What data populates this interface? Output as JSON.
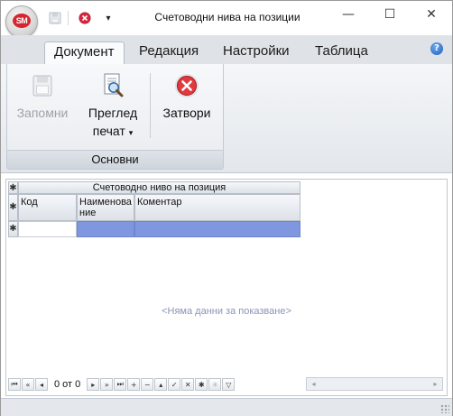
{
  "window": {
    "title": "Счетоводни нива на позиции",
    "app_badge": "SM",
    "controls": {
      "minimize": "—",
      "maximize": "☐",
      "close": "✕"
    }
  },
  "quick_access": {
    "items": [
      {
        "name": "save-icon",
        "enabled": false
      },
      {
        "name": "close-icon",
        "enabled": true
      }
    ],
    "dropdown": "▾"
  },
  "ribbon": {
    "tabs": [
      {
        "label": "Документ",
        "active": true
      },
      {
        "label": "Редакция",
        "active": false
      },
      {
        "label": "Настройки",
        "active": false
      },
      {
        "label": "Таблица",
        "active": false
      }
    ],
    "help": "?",
    "groups": [
      {
        "label": "Основни",
        "buttons": [
          {
            "label": "Запомни",
            "icon": "save-icon",
            "enabled": false
          },
          {
            "label_line1": "Преглед",
            "label_line2": "печат",
            "dropdown": "▾",
            "icon": "print-preview-icon",
            "enabled": true
          },
          {
            "label": "Затвори",
            "icon": "close-icon",
            "enabled": true
          }
        ]
      }
    ]
  },
  "grid": {
    "band_caption": "Счетоводно ниво на позиция",
    "columns": [
      {
        "label": "Код"
      },
      {
        "label": "Наименование",
        "label_line1": "Наименова",
        "label_line2": "ние"
      },
      {
        "label": "Коментар"
      }
    ],
    "rows": [],
    "empty_text": "<Няма данни за показване>",
    "row_indicator": "✱"
  },
  "navigator": {
    "position_text": "0 от 0",
    "buttons": [
      "first",
      "prev-page",
      "prev",
      "next",
      "next-page",
      "last",
      "append",
      "delete",
      "edit",
      "post",
      "cancel",
      "refresh",
      "bookmark",
      "filter"
    ]
  },
  "colors": {
    "accent": "#7f97de",
    "ribbon_bg": "#e3e7ec",
    "close_red": "#d6252f"
  }
}
